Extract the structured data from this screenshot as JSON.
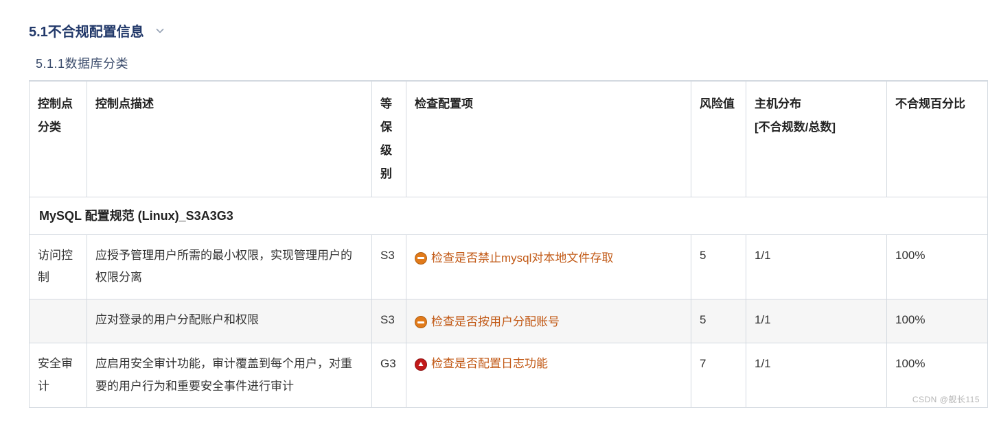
{
  "section": {
    "number_title": "5.1不合规配置信息",
    "subsection_title": "5.1.1数据库分类"
  },
  "table": {
    "title": "MySQL 配置规范 (Linux)_S3A3G3",
    "headers": {
      "category": "控制点分类",
      "description": "控制点描述",
      "level": "等保级别",
      "check_item": "检查配置项",
      "risk": "风险值",
      "distribution": "主机分布",
      "distribution_sub": "[不合规数/总数]",
      "noncompliant_pct": "不合规百分比"
    },
    "rows": [
      {
        "category": "访问控制",
        "description": "应授予管理用户所需的最小权限，实现管理用户的权限分离",
        "level": "S3",
        "severity": "warn",
        "check_item": "检查是否禁止mysql对本地文件存取",
        "risk": "5",
        "distribution": "1/1",
        "pct": "100%",
        "alt": false,
        "show_category": true
      },
      {
        "category": "",
        "description": "应对登录的用户分配账户和权限",
        "level": "S3",
        "severity": "warn",
        "check_item": "检查是否按用户分配账号",
        "risk": "5",
        "distribution": "1/1",
        "pct": "100%",
        "alt": true,
        "show_category": false
      },
      {
        "category": "安全审计",
        "description": "应启用安全审计功能，审计覆盖到每个用户，对重要的用户行为和重要安全事件进行审计",
        "level": "G3",
        "severity": "crit",
        "check_item": "检查是否配置日志功能",
        "risk": "7",
        "distribution": "1/1",
        "pct": "100%",
        "alt": false,
        "show_category": true
      }
    ]
  },
  "watermark": "CSDN @舰长115"
}
